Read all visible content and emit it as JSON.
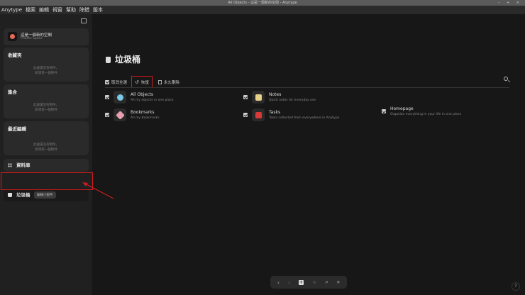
{
  "window": {
    "title": "All Objects - 這是一個新的空間 - Anytype",
    "controls": "– + ×"
  },
  "menu": [
    "Anytype",
    "檔案",
    "編輯",
    "視窗",
    "幫助",
    "除錯",
    "版本"
  ],
  "sidebar": {
    "space": {
      "name": "這是一個新的空間",
      "type": "Private Space"
    },
    "widgets": [
      {
        "title": "收藏夾",
        "empty1": "此處還沒有物件。",
        "empty2": "新增第一個物件"
      },
      {
        "title": "集合",
        "empty1": "此處還沒有物件。",
        "empty2": "新增第一個物件"
      },
      {
        "title": "最近編輯",
        "empty1": "此處還沒有物件。",
        "empty2": "新增第一個物件"
      }
    ],
    "library": "資料庫",
    "bin": "垃圾桶",
    "tooltip": "編輯小部件"
  },
  "main": {
    "title": "垃圾桶",
    "toolbar": {
      "deselect": "取消全選",
      "restore": "恢復",
      "delete": "永久刪除"
    },
    "items": [
      {
        "name": "All Objects",
        "desc": "All my objects in one place",
        "color": "#7cc8e8"
      },
      {
        "name": "Notes",
        "desc": "Quick notes for everyday use",
        "color": "#e8d28a"
      },
      {
        "name": "Homepage",
        "desc": "Organize everything in your life in one place",
        "color": "#2a2a2a"
      },
      {
        "name": "Bookmarks",
        "desc": "All my Bookmarks",
        "color": "#e8a0b0"
      },
      {
        "name": "Tasks",
        "desc": "Tasks collected from everywhere in Anytype",
        "color": "#d83a3a"
      }
    ]
  },
  "navbar": {
    "back": "‹",
    "forward": "›",
    "add": "+",
    "graph": "⁘",
    "search": "⌕",
    "extra": "●"
  },
  "help": "?"
}
